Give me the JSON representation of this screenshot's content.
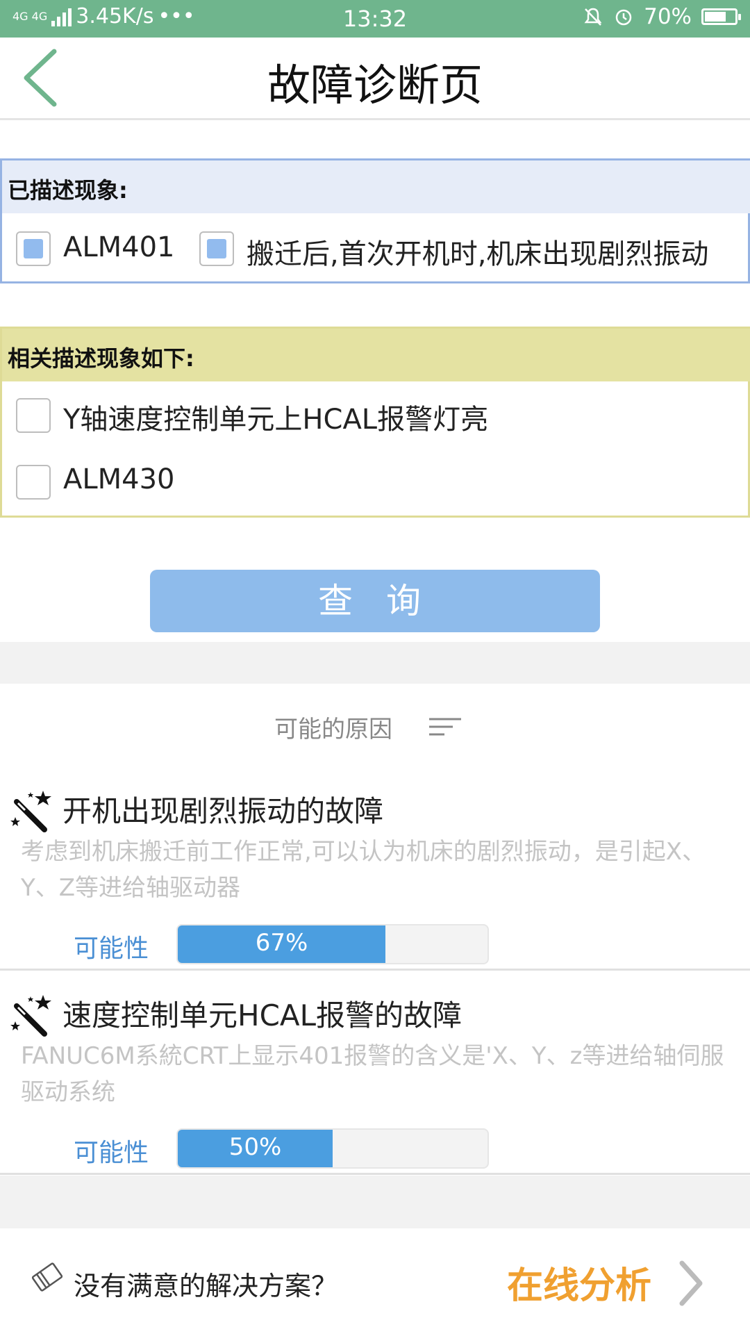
{
  "status_bar": {
    "network": "4G 4G",
    "speed": "3.45K/s",
    "more": "•••",
    "time": "13:32",
    "battery": "70%"
  },
  "header": {
    "title": "故障诊断页"
  },
  "described": {
    "label": "已描述现象:",
    "items": [
      {
        "label": "ALM401",
        "checked": true
      },
      {
        "label": "搬迁后,首次开机时,机床出现剧烈振动",
        "checked": true
      }
    ]
  },
  "related": {
    "label": "相关描述现象如下:",
    "items": [
      {
        "label": "Y轴速度控制单元上HCAL报警灯亮",
        "checked": false
      },
      {
        "label": "ALM430",
        "checked": false
      }
    ]
  },
  "query_button": "查 询",
  "causes_heading": "可能的原因",
  "causes": [
    {
      "title": "开机出现剧烈振动的故障",
      "description": "考虑到机床搬迁前工作正常,可以认为机床的剧烈振动，是引起X、Y、Z等进给轴驱动器",
      "possibility_label": "可能性",
      "possibility": 0.67,
      "possibility_text": "67%"
    },
    {
      "title": "速度控制单元HCAL报警的故障",
      "description": "FANUC6M系統CRT上显示401报警的含义是'X、Y、z等进给轴伺服驱动系统",
      "possibility_label": "可能性",
      "possibility": 0.5,
      "possibility_text": "50%"
    }
  ],
  "footer": {
    "question": "没有满意的解决方案？",
    "link": "在线分析"
  },
  "colors": {
    "status_bar": "#6fb58d",
    "accent_blue": "#4b9ee0",
    "query_button": "#8ebbeb",
    "online_link": "#f0a030"
  }
}
